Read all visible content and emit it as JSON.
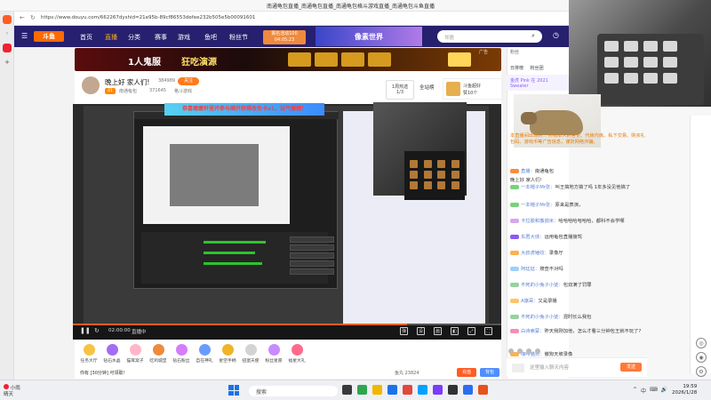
{
  "browser": {
    "title": "南通龟包直播_南通龟包直播_南通龟包格斗游戏直播_南通龟包斗鱼直播",
    "url": "https://www.douyu.com/662267dyshid=21e95b-89cf86553defee232b505e5b00091601",
    "window_controls": [
      "—",
      "□",
      "✕"
    ]
  },
  "nav": {
    "logo": "斗鱼",
    "items": [
      "首页",
      "直播",
      "分类",
      "赛事",
      "游戏",
      "鱼吧",
      "粉丝节"
    ],
    "active": "直播",
    "notice_line1": "报名活动100",
    "notice_line2": "04:05:23",
    "banner": "像素世界",
    "search_placeholder": "邻居"
  },
  "ad": {
    "text1": "1人鬼服",
    "text2": "狂吃演源",
    "tag": "广告"
  },
  "room": {
    "title": "晚上好 家人们!",
    "likes": "384989",
    "follow": "关注",
    "level": "41",
    "host": "南通龟包",
    "fans": "371645",
    "category": "格斗游戏",
    "rank_label": "1周热选",
    "rank_value": "1/3",
    "watch_all": "全站榜",
    "guild": "斗鱼超好",
    "guild_count": "赞10个"
  },
  "player": {
    "promo": "恭喜嫩嫩轩里开参与继开获得改名卡x1，玩气爆棚！",
    "time": "02:00:00",
    "status": "直播中",
    "progress": 0.78,
    "control_icons": [
      "弹",
      "设",
      "画",
      "◧",
      "⤢",
      "⛶"
    ]
  },
  "gifts": [
    {
      "name": "任务大厅",
      "color": "#f6c344"
    },
    {
      "name": "钻石水晶",
      "color": "#a46cf5"
    },
    {
      "name": "猫耳窝子",
      "color": "#ffb6c9"
    },
    {
      "name": "吃鸡城堡",
      "color": "#ef8a3c"
    },
    {
      "name": "钻石粉丝",
      "color": "#d57cfb"
    },
    {
      "name": "自在神礼",
      "color": "#6a9cff"
    },
    {
      "name": "星空手柄",
      "color": "#f0b429"
    },
    {
      "name": "扭蛋天使",
      "color": "#d3d3d3"
    },
    {
      "name": "粉丝星愿",
      "color": "#c98bff"
    },
    {
      "name": "福星大礼",
      "color": "#ff6b8b"
    }
  ],
  "gift_bar": {
    "hint": "你有 [30分钟] 可领取!",
    "fishball": "鱼丸 23824",
    "charge": "充值",
    "backpack": "背包"
  },
  "chat": {
    "header": "粉丝",
    "tab_rank": "日排榜",
    "tab_fans": "粉丝团",
    "contrib": "贡献榜",
    "user_box": "金虎 Pink 在 2021 Sweater",
    "notice": "本直播间出现的... 所有本人的言论、代练代练、私下交易、购买礼包码、游戏币等广告信息，谨防网络诈骗。",
    "messages": [
      {
        "user": "直播：",
        "text": "南通龟包",
        "badge": "#ff8a3c"
      },
      {
        "user": "",
        "text": "晚上好 家人们!",
        "badge": ""
      },
      {
        "user": "一本帽子Mr张：",
        "text": "叫王搞地方搞了吗 1年多没见他搞了",
        "badge": "#7ad27a"
      },
      {
        "user": "一本帽子Mr张：",
        "text": "原来是表演，",
        "badge": "#7ad27a"
      },
      {
        "user": "卡拉胶和搬鸽米：",
        "text": "哈哈哈哈哈哈哈，都科不会学哪",
        "badge": "#d8a7f0"
      },
      {
        "user": "东君大侠：",
        "text": "运用龟包直播接驾",
        "badge": "#8b5cf6"
      },
      {
        "user": "大叔虎锤纹：",
        "text": "录像厅",
        "badge": "#ffb14d"
      },
      {
        "user": "阿廷廷：",
        "text": "搜查不对吗",
        "badge": "#a0d0ff"
      },
      {
        "user": "不死的小兔子小徒：",
        "text": "包双满了罚罪",
        "badge": "#9ad2a0"
      },
      {
        "user": "A旗哥：",
        "text": "又是录播",
        "badge": "#ffc36a"
      },
      {
        "user": "不死的小兔子小徒：",
        "text": "混时长么我包",
        "badge": "#9ad2a0"
      },
      {
        "user": "白诗索蒙：",
        "text": "昨天我刚加他，怎么才看三分钟包王就不玩了?",
        "badge": "#f38fb2"
      },
      {
        "user": "咖啡猫势：",
        "text": "傲狗天坡录像",
        "badge": "#ffb14d"
      },
      {
        "user": "DtsMania",
        "text": "来了",
        "badge": "#7e8dff"
      }
    ],
    "input_placeholder": "这里输入聊天内容",
    "send": "发送"
  },
  "taskbar": {
    "weather_line1": "小雨",
    "weather_line2": "晴天",
    "search": "搜索",
    "time": "19:59",
    "date": "2026/1/28",
    "tray": [
      "^",
      "中",
      "⌨",
      "🔊"
    ]
  },
  "right_panel_icons": [
    "◎",
    "◉",
    "⚙"
  ]
}
